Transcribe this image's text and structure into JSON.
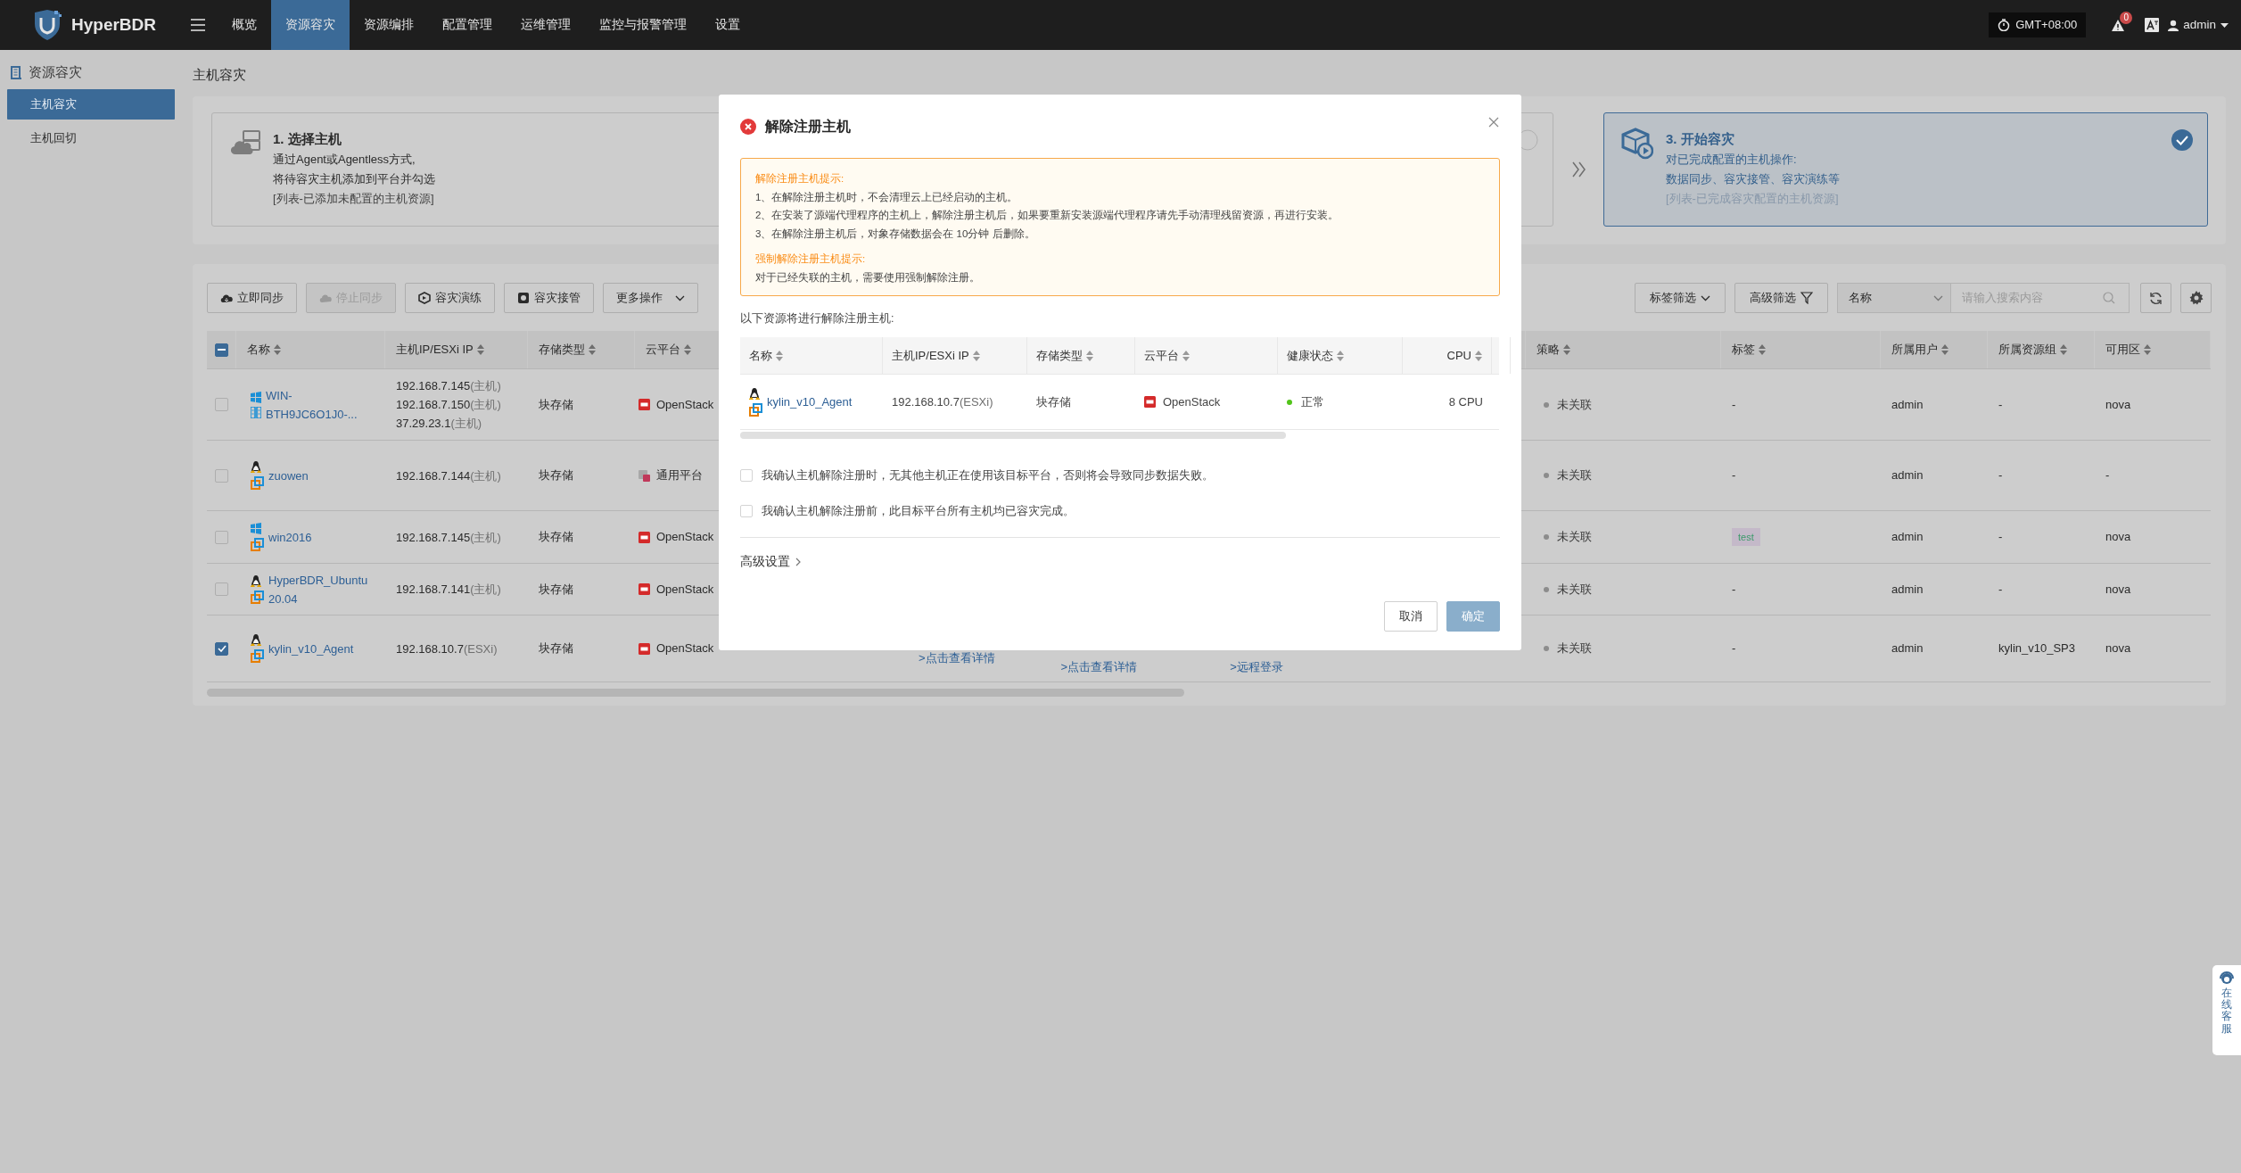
{
  "topbar": {
    "brand": "HyperBDR",
    "menu": [
      {
        "label": "概览",
        "selected": false
      },
      {
        "label": "资源容灾",
        "selected": true
      },
      {
        "label": "资源编排",
        "selected": false
      },
      {
        "label": "配置管理",
        "selected": false
      },
      {
        "label": "运维管理",
        "selected": false
      },
      {
        "label": "监控与报警管理",
        "selected": false
      },
      {
        "label": "设置",
        "selected": false
      }
    ],
    "timezone": "GMT+08:00",
    "alert_count": "0",
    "user": "admin"
  },
  "sidebar": {
    "section": "资源容灾",
    "items": [
      {
        "label": "主机容灾",
        "selected": true
      },
      {
        "label": "主机回切",
        "selected": false
      }
    ]
  },
  "page_title": "主机容灾",
  "steps": [
    {
      "title": "1. 选择主机",
      "lines": [
        "通过Agent或Agentless方式,",
        "将待容灾主机添加到平台并勾选"
      ],
      "note": "[列表-已添加未配置的主机资源]",
      "selected": false
    },
    {
      "selected": false
    },
    {
      "title": "3. 开始容灾",
      "lines": [
        "对已完成配置的主机操作:",
        "数据同步、容灾接管、容灾演练等"
      ],
      "note": "[列表-已完成容灾配置的主机资源]",
      "selected": true
    }
  ],
  "toolbar": {
    "buttons": [
      {
        "label": "立即同步",
        "disabled": false
      },
      {
        "label": "停止同步",
        "disabled": true
      },
      {
        "label": "容灾演练",
        "disabled": false
      },
      {
        "label": "容灾接管",
        "disabled": false
      }
    ],
    "more": "更多操作",
    "tag_filter": "标签筛选",
    "advanced_filter": "高级筛选",
    "search_by": "名称",
    "search_placeholder": "请输入搜索内容"
  },
  "table": {
    "select_all_indeterminate": true,
    "left_columns": [
      "名称",
      "主机IP/ESXi IP",
      "存储类型",
      "云平台"
    ],
    "right_columns": [
      "策略",
      "标签",
      "所属用户",
      "所属资源组",
      "可用区"
    ],
    "rows": [
      {
        "checked": false,
        "os": {
          "kind": "windows"
        },
        "host": {
          "kind": "physical"
        },
        "name": "WIN-BTH9JC6O1J0-...",
        "ips": [
          {
            "ip": "192.168.7.145",
            "type": "(主机)"
          },
          {
            "ip": "192.168.7.150",
            "type": "(主机)"
          },
          {
            "ip": "37.29.23.1",
            "type": "(主机)"
          }
        ],
        "storage": "块存储",
        "cloud": {
          "kind": "openstack",
          "label": "OpenStack"
        },
        "policy": "未关联",
        "tag": {
          "kind": "text",
          "label": "-"
        },
        "user": "admin",
        "group": "-",
        "zone": "nova"
      },
      {
        "checked": false,
        "os": {
          "kind": "linux"
        },
        "host": {
          "kind": "vm"
        },
        "name": "zuowen",
        "ips": [
          {
            "ip": "192.168.7.144",
            "type": "(主机)"
          }
        ],
        "storage": "块存储",
        "cloud": {
          "kind": "generic",
          "label": "通用平台"
        },
        "policy": "未关联",
        "tag": {
          "kind": "text",
          "label": "-"
        },
        "user": "admin",
        "group": "-",
        "zone": "-"
      },
      {
        "checked": false,
        "os": {
          "kind": "windows"
        },
        "host": {
          "kind": "vm"
        },
        "name": "win2016",
        "ips": [
          {
            "ip": "192.168.7.145",
            "type": "(主机)"
          }
        ],
        "storage": "块存储",
        "cloud": {
          "kind": "openstack",
          "label": "OpenStack"
        },
        "policy": "未关联",
        "tag": {
          "kind": "badge",
          "label": "test"
        },
        "user": "admin",
        "group": "-",
        "zone": "nova"
      },
      {
        "checked": false,
        "os": {
          "kind": "linux"
        },
        "host": {
          "kind": "vm"
        },
        "name": "HyperBDR_Ubuntu20.04",
        "ips": [
          {
            "ip": "192.168.7.141",
            "type": "(主机)"
          }
        ],
        "storage": "块存储",
        "cloud": {
          "kind": "openstack",
          "label": "OpenStack"
        },
        "policy": "未关联",
        "tag": {
          "kind": "text",
          "label": "-"
        },
        "user": "admin",
        "group": "-",
        "zone": "nova"
      },
      {
        "checked": true,
        "os": {
          "kind": "linux"
        },
        "host": {
          "kind": "vm"
        },
        "name": "kylin_v10_Agent",
        "ips": [
          {
            "ip": "192.168.10.7",
            "type": "(ESXi)"
          }
        ],
        "storage": "块存储",
        "cloud": {
          "kind": "openstack",
          "label": "OpenStack"
        },
        "links": [
          ">点击查看详情",
          ">点击查看详情",
          ">远程登录"
        ],
        "policy": "未关联",
        "tag": {
          "kind": "text",
          "label": "-"
        },
        "user": "admin",
        "group": "kylin_v10_SP3",
        "zone": "nova"
      }
    ]
  },
  "modal": {
    "title": "解除注册主机",
    "alert": {
      "heading": "解除注册主机提示:",
      "items": [
        "1、在解除注册主机时，不会清理云上已经启动的主机。",
        "2、在安装了源端代理程序的主机上，解除注册主机后，如果要重新安装源端代理程序请先手动清理残留资源，再进行安装。",
        "3、在解除注册主机后，对象存储数据会在 10分钟 后删除。"
      ],
      "force_heading": "强制解除注册主机提示:",
      "force_text": "对于已经失联的主机，需要使用强制解除注册。"
    },
    "intro": "以下资源将进行解除注册主机:",
    "columns": [
      "名称",
      "主机IP/ESXi IP",
      "存储类型",
      "云平台",
      "健康状态",
      "CPU"
    ],
    "rows": [
      {
        "os": {
          "kind": "linux"
        },
        "host": {
          "kind": "vm"
        },
        "name": "kylin_v10_Agent",
        "ip": "192.168.10.7",
        "ip_type": "(ESXi)",
        "storage": "块存储",
        "cloud": {
          "kind": "openstack",
          "label": "OpenStack"
        },
        "health": {
          "label": "正常",
          "color": "#52c41a"
        },
        "cpu": "8 CPU"
      }
    ],
    "confirms": [
      {
        "label": "我确认主机解除注册时，无其他主机正在使用该目标平台，否则将会导致同步数据失败。",
        "checked": false
      },
      {
        "label": "我确认主机解除注册前，此目标平台所有主机均已容灾完成。",
        "checked": false
      }
    ],
    "advanced": "高级设置",
    "cancel": "取消",
    "ok": {
      "label": "确定",
      "disabled": true
    }
  },
  "help_widget": "在线客服"
}
